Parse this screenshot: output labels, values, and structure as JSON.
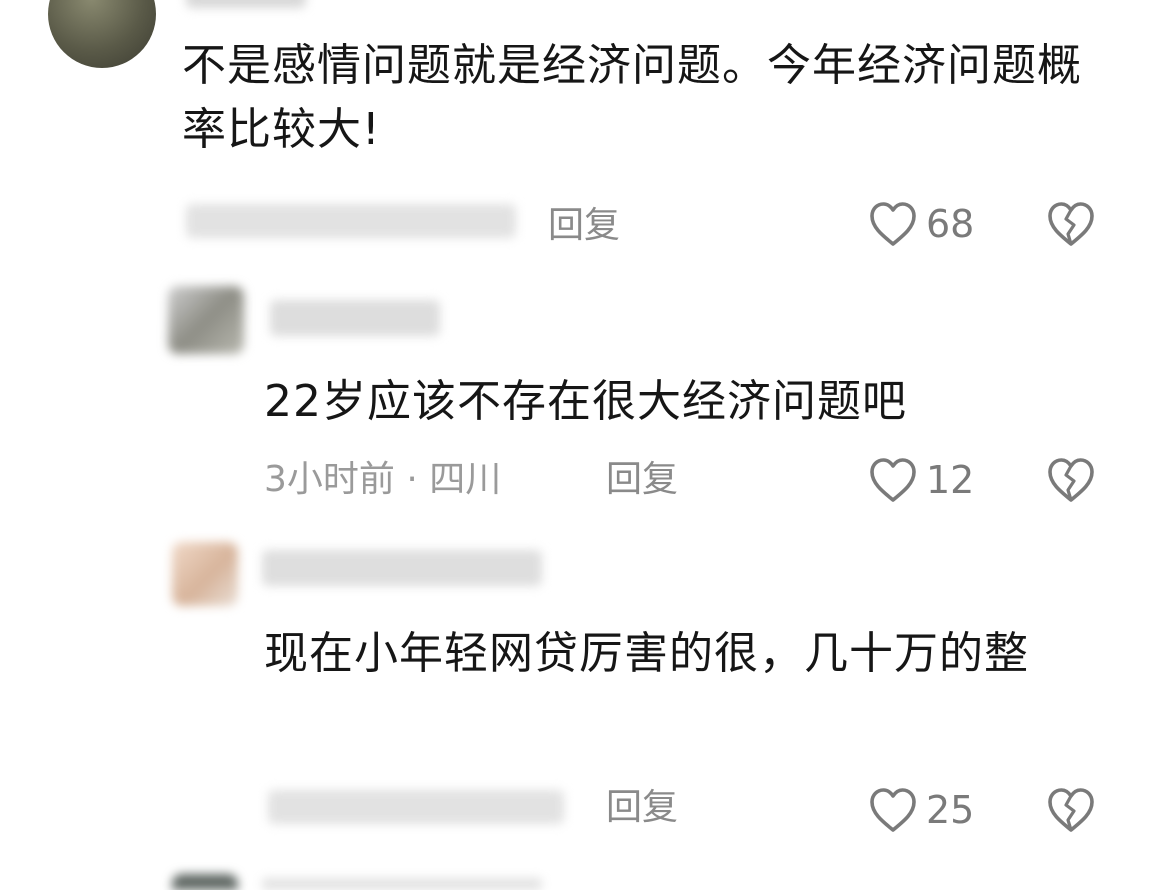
{
  "comments": [
    {
      "text": "不是感情问题就是经济问题。今年经济问题概率比较大!",
      "reply_label": "回复",
      "likes": "68"
    },
    {
      "text": "22岁应该不存在很大经济问题吧",
      "meta": "3小时前 · 四川",
      "reply_label": "回复",
      "likes": "12"
    },
    {
      "text": "现在小年轻网贷厉害的很，几十万的整",
      "reply_label": "回复",
      "likes": "25"
    }
  ],
  "icons": {
    "like": "heart-outline-icon",
    "dislike": "broken-heart-icon"
  },
  "colors": {
    "text": "#161616",
    "meta": "#9a9a9a",
    "icon": "#7a7a7a"
  }
}
